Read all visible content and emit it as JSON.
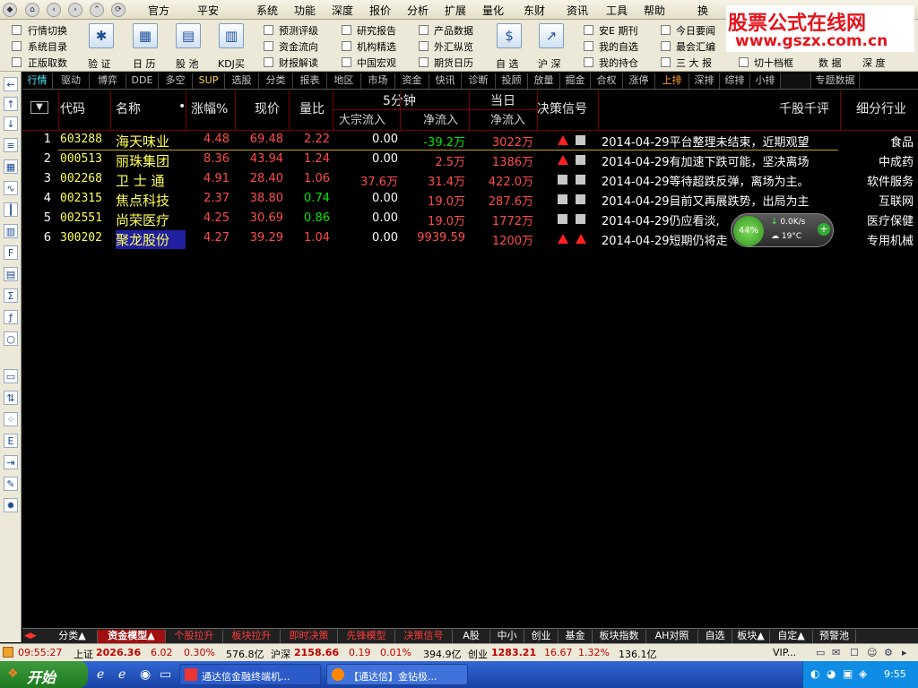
{
  "menubar": {
    "items": [
      "官方",
      "平安",
      "系统",
      "功能",
      "深度",
      "报价",
      "分析",
      "扩展",
      "量化",
      "东财",
      "资讯",
      "工具",
      "帮助",
      "换"
    ]
  },
  "logo": {
    "line1": "股票公式在线网",
    "line2": "www.gszx.com.cn"
  },
  "toolbar": {
    "checks_col1": [
      "行情切换",
      "系统目录",
      "正版取数"
    ],
    "big_buttons": [
      {
        "label": "验 证",
        "icon": "fan-icon"
      },
      {
        "label": "日 历",
        "icon": "calendar-icon"
      },
      {
        "label": "股 池",
        "icon": "grid-icon"
      },
      {
        "label": "KDJ买",
        "icon": "chart-icon"
      }
    ],
    "checks_col2": [
      "预测评级",
      "资金流向",
      "财报解读"
    ],
    "checks_col3": [
      "研究报告",
      "机构精选",
      "中国宏观"
    ],
    "checks_col4": [
      "产品数据",
      "外汇纵览",
      "期货日历"
    ],
    "big_buttons2": [
      {
        "label": "自 选",
        "icon": "dollar-icon"
      },
      {
        "label": "沪 深",
        "icon": "chart-line-icon"
      }
    ],
    "checks_col5": [
      "安E 期刊",
      "我的自选",
      "我的持仓"
    ],
    "checks_col6": [
      "今日要闻",
      "最会汇编",
      "三 大 报"
    ],
    "checks_col7": [
      "",
      "",
      "切十档框"
    ],
    "right_labels": [
      "数 据",
      "深 度"
    ]
  },
  "tabs": [
    "行情",
    "驱动",
    "博弈",
    "DDE",
    "多空",
    "SUP",
    "选股",
    "分类",
    "报表",
    "地区",
    "市场",
    "资金",
    "快讯",
    "诊断",
    "投顾",
    "放量",
    "掘金",
    "合权",
    "涨停",
    "上排",
    "深排",
    "综排",
    "小排",
    "",
    "专题数据"
  ],
  "header": {
    "sort": "▼",
    "code": "代码",
    "name": "名称",
    "dot": "•",
    "change": "涨幅%",
    "price": "现价",
    "vol_ratio": "量比",
    "five_min": "5分钟",
    "today": "当日",
    "big_inflow": "大宗流入",
    "net_inflow": "净流入",
    "today_net": "净流入",
    "signal": "决策信号",
    "comment": "千股千评",
    "industry": "细分行业"
  },
  "rows": [
    {
      "idx": "1",
      "code": "603288",
      "name": "海天味业",
      "change": "4.48",
      "price": "69.48",
      "vr": "2.22",
      "vr_color": "red",
      "big": "0.00",
      "net": "-39.2万",
      "net_color": "grn",
      "today": "3022万",
      "sig1": "up",
      "sig2": "sq",
      "comment": "2014-04-29平台整理未结束，近期观望",
      "industry": "食品"
    },
    {
      "idx": "2",
      "code": "000513",
      "name": "丽珠集团",
      "change": "8.36",
      "price": "43.94",
      "vr": "1.24",
      "vr_color": "red",
      "big": "0.00",
      "net": "2.5万",
      "net_color": "red",
      "today": "1386万",
      "sig1": "up",
      "sig2": "sq",
      "comment": "2014-04-29有加速下跌可能，坚决离场",
      "industry": "中成药"
    },
    {
      "idx": "3",
      "code": "002268",
      "name": "卫 士 通",
      "change": "4.91",
      "price": "28.40",
      "vr": "1.06",
      "vr_color": "red",
      "big": "37.6万",
      "net": "31.4万",
      "net_color": "red",
      "today": "422.0万",
      "sig1": "sq",
      "sig2": "sq",
      "comment": "2014-04-29等待超跌反弹，离场为主。",
      "industry": "软件服务"
    },
    {
      "idx": "4",
      "code": "002315",
      "name": "焦点科技",
      "change": "2.37",
      "price": "38.80",
      "vr": "0.74",
      "vr_color": "grn",
      "big": "0.00",
      "net": "19.0万",
      "net_color": "red",
      "today": "287.6万",
      "sig1": "sq",
      "sig2": "sq",
      "comment": "2014-04-29目前又再展跌势，出局为主",
      "industry": "互联网"
    },
    {
      "idx": "5",
      "code": "002551",
      "name": "尚荣医疗",
      "change": "4.25",
      "price": "30.69",
      "vr": "0.86",
      "vr_color": "grn",
      "big": "0.00",
      "net": "19.0万",
      "net_color": "red",
      "today": "1772万",
      "sig1": "sq",
      "sig2": "sq",
      "comment": "2014-04-29仍应看淡,",
      "industry": "医疗保健"
    },
    {
      "idx": "6",
      "code": "300202",
      "name": "聚龙股份",
      "change": "4.27",
      "price": "39.29",
      "vr": "1.04",
      "vr_color": "red",
      "big": "0.00",
      "net": "9939.59",
      "net_color": "red",
      "today": "1200万",
      "sig1": "up",
      "sig2": "up",
      "comment": "2014-04-29短期仍将走",
      "industry": "专用机械"
    }
  ],
  "widget": {
    "cpu": "44%",
    "speed": "0.0K/s",
    "temp": "19°C"
  },
  "bottom_tabs": [
    {
      "label": "分类▲",
      "color": "#ffffff"
    },
    {
      "label": "资金模型▲",
      "color": "#ffffff"
    },
    {
      "label": "个股拉升",
      "color": "#ff3b3b"
    },
    {
      "label": "板块拉升",
      "color": "#ff3b3b"
    },
    {
      "label": "即时决策",
      "color": "#ff3b3b"
    },
    {
      "label": "先锋模型",
      "color": "#ff3b3b"
    },
    {
      "label": "决策信号",
      "color": "#ff3b3b"
    },
    {
      "label": "A股",
      "color": "#ffffff"
    },
    {
      "label": "中小",
      "color": "#ffffff"
    },
    {
      "label": "创业",
      "color": "#ffffff"
    },
    {
      "label": "基金",
      "color": "#ffffff"
    },
    {
      "label": "板块指数",
      "color": "#ffffff"
    },
    {
      "label": "AH对照",
      "color": "#ffffff"
    },
    {
      "label": "自选",
      "color": "#ffffff"
    },
    {
      "label": "板块▲",
      "color": "#ffffff"
    },
    {
      "label": "自定▲",
      "color": "#ffffff"
    },
    {
      "label": "预警池",
      "color": "#ffffff"
    }
  ],
  "status": {
    "time": "09:55:27",
    "sh_label": "上证",
    "sh_index": "2026.36",
    "sh_chg": "6.02",
    "sh_pct": "0.30%",
    "sh_amt": "576.8亿",
    "sz_label": "沪深",
    "sz_index": "2158.66",
    "sz_chg": "0.19",
    "sz_pct": "0.01%",
    "sz_amt": "394.9亿",
    "cy_label": "创业",
    "cy_index": "1283.21",
    "cy_chg": "16.67",
    "cy_pct": "1.32%",
    "cy_amt": "136.1亿",
    "vip": "VIP..."
  },
  "taskbar": {
    "start": "开始",
    "task1": "通达信金融终端机...",
    "task2": "【通达信】金钻极...",
    "clock": "9:55"
  }
}
